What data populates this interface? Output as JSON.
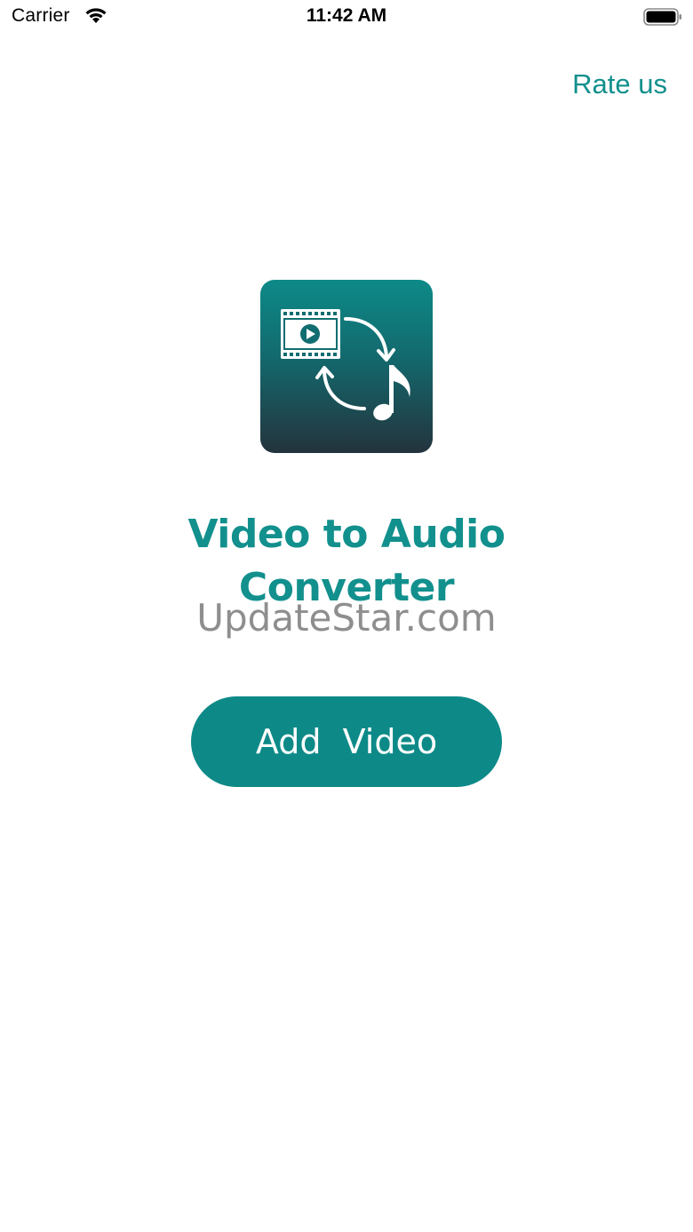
{
  "status_bar": {
    "carrier": "Carrier",
    "time": "11:42 AM",
    "icons": [
      "wifi-icon",
      "battery-icon"
    ]
  },
  "header": {
    "rate_us_label": "Rate us"
  },
  "logo": {
    "icon": "video-to-audio-convert-icon"
  },
  "title": "Video to Audio Converter",
  "watermark": "UpdateStar.com",
  "add_video_label": "Add  Video",
  "colors": {
    "accent": "#12908d",
    "button": "#0d8a88",
    "logo_gradient_top": "#0d8a88",
    "logo_gradient_bottom": "#24333d"
  }
}
